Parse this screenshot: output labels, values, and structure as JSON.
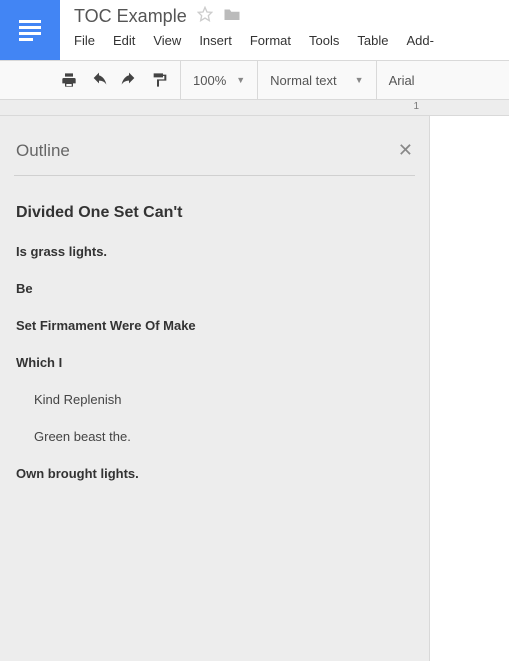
{
  "header": {
    "title": "TOC Example",
    "menu": [
      "File",
      "Edit",
      "View",
      "Insert",
      "Format",
      "Tools",
      "Table",
      "Add-"
    ]
  },
  "toolbar": {
    "zoom": "100%",
    "style": "Normal text",
    "font": "Arial"
  },
  "ruler": {
    "mark1": "1"
  },
  "outline": {
    "title": "Outline",
    "items": [
      {
        "label": "Divided One Set Can't",
        "level": "h1"
      },
      {
        "label": "Is grass lights.",
        "level": "h2"
      },
      {
        "label": "Be",
        "level": "h2"
      },
      {
        "label": "Set Firmament Were Of Make",
        "level": "h2"
      },
      {
        "label": "Which I",
        "level": "h2"
      },
      {
        "label": "Kind Replenish",
        "level": "h3"
      },
      {
        "label": "Green beast the.",
        "level": "h3"
      },
      {
        "label": "Own brought lights.",
        "level": "h2"
      }
    ]
  }
}
